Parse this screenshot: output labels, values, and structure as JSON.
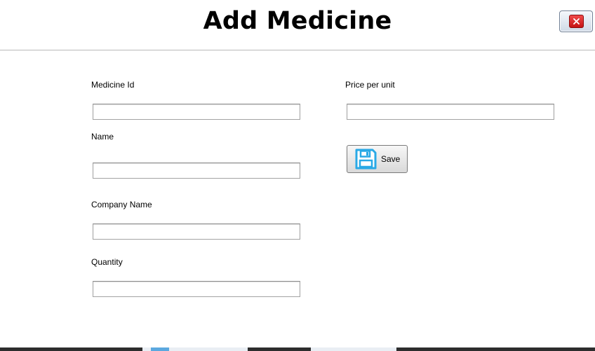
{
  "header": {
    "title": "Add Medicine"
  },
  "window": {
    "close_icon": "close-icon"
  },
  "form": {
    "medicine_id": {
      "label": "Medicine Id",
      "value": ""
    },
    "name": {
      "label": "Name",
      "value": ""
    },
    "company_name": {
      "label": "Company Name",
      "value": ""
    },
    "quantity": {
      "label": "Quantity",
      "value": ""
    },
    "price_per_unit": {
      "label": "Price per unit",
      "value": ""
    }
  },
  "actions": {
    "save_label": "Save",
    "save_icon": "floppy-disk-icon"
  },
  "colors": {
    "close_red": "#d8211f",
    "save_icon_blue": "#29a9e6"
  }
}
